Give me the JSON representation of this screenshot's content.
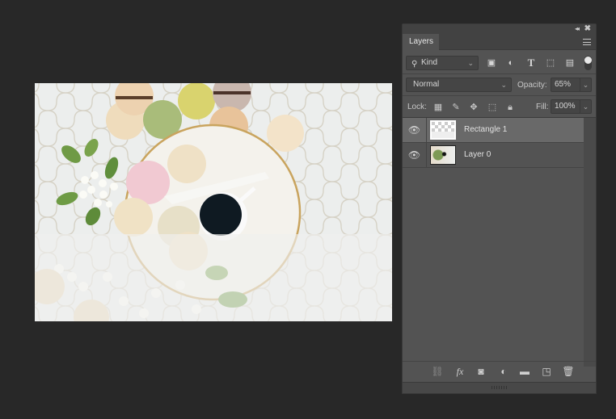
{
  "canvas": {
    "document_name": "macarons-photo",
    "overlay_layer_opacity_percent": 65
  },
  "panel": {
    "tab_label": "Layers",
    "collapse_glyph": "◂◂",
    "close_glyph": "✖",
    "filter": {
      "kind_label": "Kind",
      "icons": [
        "image-filter-icon",
        "adjustment-filter-icon",
        "type-filter-icon",
        "shape-filter-icon",
        "smart-object-filter-icon"
      ]
    },
    "blend_mode": "Normal",
    "opacity_label": "Opacity:",
    "opacity_value": "65%",
    "lock_label": "Lock:",
    "lock_icons": [
      "lock-transparent-pixels-icon",
      "lock-image-pixels-icon",
      "lock-position-icon",
      "lock-artboard-icon",
      "lock-all-icon"
    ],
    "fill_label": "Fill:",
    "fill_value": "100%",
    "layers": [
      {
        "name": "Rectangle 1",
        "visible": true,
        "selected": true,
        "type": "shape"
      },
      {
        "name": "Layer 0",
        "visible": true,
        "selected": false,
        "type": "image"
      }
    ],
    "footer_icons": [
      "link-layers-icon",
      "fx-icon",
      "add-mask-icon",
      "new-adjustment-layer-icon",
      "new-group-icon",
      "new-layer-icon",
      "delete-layer-icon"
    ]
  }
}
